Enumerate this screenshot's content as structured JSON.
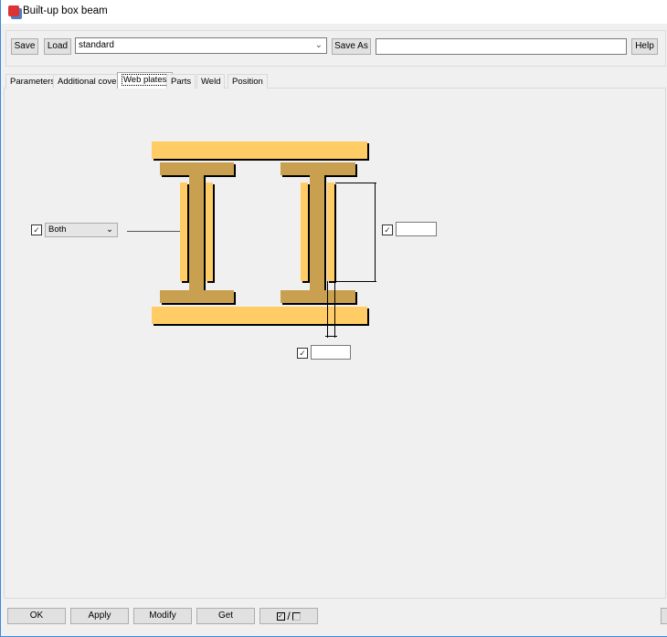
{
  "window": {
    "title": "Built-up box beam"
  },
  "toolbar": {
    "save_label": "Save",
    "load_label": "Load",
    "preset_value": "standard",
    "save_as_label": "Save As",
    "save_as_value": "",
    "help_label": "Help"
  },
  "tabs": [
    {
      "label": "Parameters"
    },
    {
      "label": "Additional cover"
    },
    {
      "label": "Web plates"
    },
    {
      "label": "Parts"
    },
    {
      "label": "Weld"
    },
    {
      "label": "Position"
    }
  ],
  "web_plates": {
    "side_option": "Both",
    "side_checked": true,
    "height_checked": true,
    "height_value": "",
    "thickness_checked": true,
    "thickness_value": ""
  },
  "footer": {
    "ok_label": "OK",
    "apply_label": "Apply",
    "modify_label": "Modify",
    "get_label": "Get",
    "toggle_label": "/"
  },
  "colors": {
    "plate": "#ffcc66",
    "beam": "#c8a050"
  }
}
